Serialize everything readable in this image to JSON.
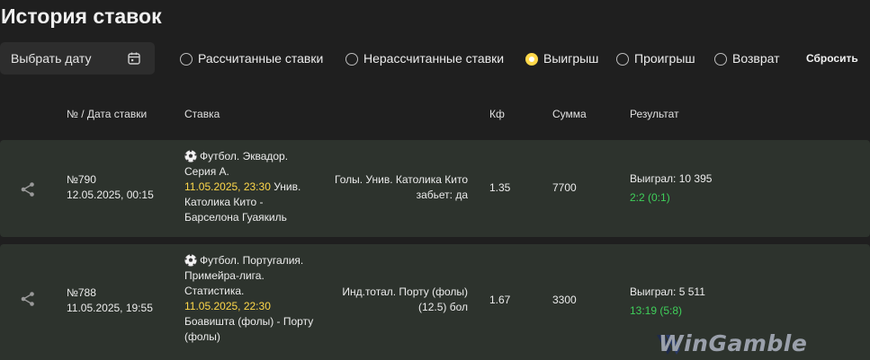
{
  "page": {
    "title": "История ставок"
  },
  "filters": {
    "date_picker_label": "Выбрать дату",
    "options": [
      {
        "label": "Рассчитанные ставки",
        "selected": false
      },
      {
        "label": "Нерассчитанные ставки",
        "selected": false
      },
      {
        "label": "Выигрыш",
        "selected": true
      },
      {
        "label": "Проигрыш",
        "selected": false
      },
      {
        "label": "Возврат",
        "selected": false
      }
    ],
    "reset_label": "Сбросить"
  },
  "table": {
    "headers": {
      "number_date": "№ / Дата ставки",
      "bet": "Ставка",
      "coef": "Кф",
      "sum": "Сумма",
      "result": "Результат"
    },
    "rows": [
      {
        "number": "№790",
        "date": "12.05.2025, 00:15",
        "event_title": "Футбол. Эквадор. Серия А.",
        "event_datetime": "11.05.2025, 23:30",
        "event_teams": "Унив. Католика Кито - Барселона Гуаякиль",
        "market_line1": "Голы. Унив. Католика Кито",
        "market_line2": "забьет: да",
        "coef": "1.35",
        "sum": "7700",
        "result": "Выиграл: 10 395",
        "score": "2:2 (0:1)"
      },
      {
        "number": "№788",
        "date": "11.05.2025, 19:55",
        "event_title": "Футбол. Португалия. Примейра-лига. Статистика.",
        "event_datetime": "11.05.2025, 22:30",
        "event_teams": "Боавишта (фолы) - Порту (фолы)",
        "market_line1": "Инд.тотал. Порту (фолы)",
        "market_line2": "(12.5) бол",
        "coef": "1.67",
        "sum": "3300",
        "result": "Выиграл: 5 511",
        "score": "13:19 (5:8)"
      }
    ]
  },
  "watermark": {
    "text": "WinGamble"
  },
  "colors": {
    "accent": "#ffd84a",
    "win": "#3fcf5a",
    "row_bg": "#2d332d",
    "page_bg": "#1f1f1f"
  },
  "icons": {
    "date": "calendar-icon",
    "row_action": "share-icon",
    "sport": "soccer-ball-icon"
  }
}
